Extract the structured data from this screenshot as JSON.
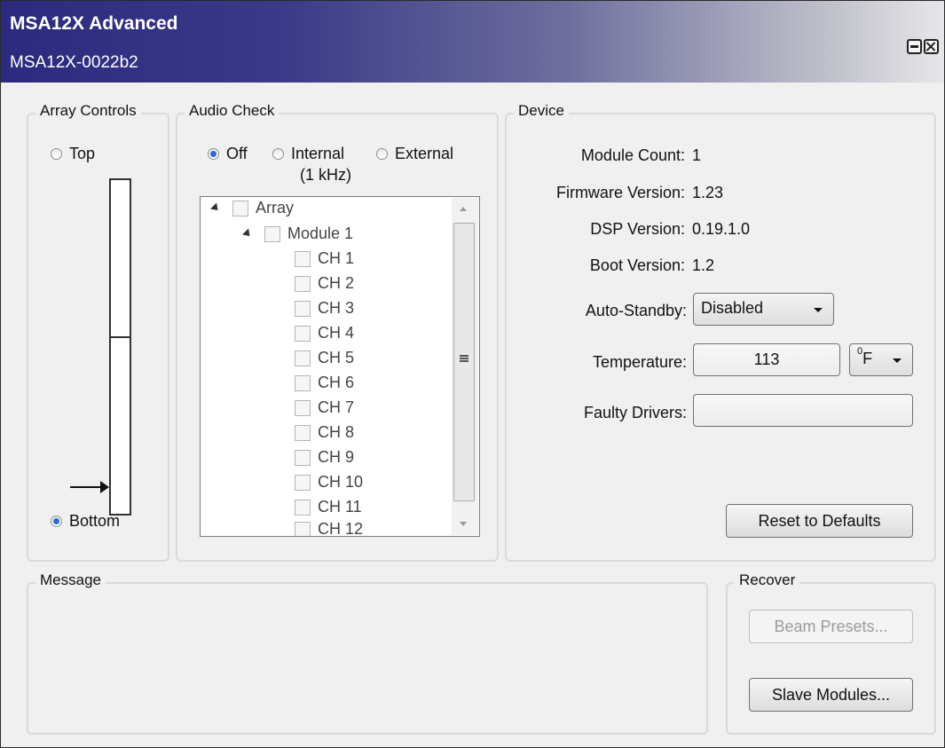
{
  "window": {
    "app_title": "MSA12X Advanced",
    "device_name": "MSA12X-0022b2"
  },
  "array_controls": {
    "legend": "Array Controls",
    "top_label": "Top",
    "bottom_label": "Bottom",
    "selected": "Bottom"
  },
  "audio_check": {
    "legend": "Audio Check",
    "options": [
      {
        "label": "Off",
        "selected": true
      },
      {
        "label": "Internal",
        "sublabel": "(1 kHz)",
        "selected": false
      },
      {
        "label": "External",
        "selected": false
      }
    ],
    "tree": {
      "root": "Array",
      "module": "Module 1",
      "channels": [
        "CH 1",
        "CH 2",
        "CH 3",
        "CH 4",
        "CH 5",
        "CH 6",
        "CH 7",
        "CH 8",
        "CH 9",
        "CH 10",
        "CH 11",
        "CH 12"
      ]
    }
  },
  "device": {
    "legend": "Device",
    "module_count_label": "Module Count:",
    "module_count": "1",
    "firmware_label": "Firmware Version:",
    "firmware": "1.23",
    "dsp_label": "DSP Version:",
    "dsp": "0.19.1.0",
    "boot_label": "Boot Version:",
    "boot": "1.2",
    "auto_standby_label": "Auto-Standby:",
    "auto_standby": "Disabled",
    "temperature_label": "Temperature:",
    "temperature": "113",
    "temp_unit_degree": "0",
    "temp_unit_letter": "F",
    "faulty_label": "Faulty Drivers:",
    "faulty": "",
    "reset_button": "Reset to Defaults"
  },
  "message": {
    "legend": "Message",
    "text": ""
  },
  "recover": {
    "legend": "Recover",
    "beam_presets_button": "Beam Presets...",
    "slave_modules_button": "Slave Modules..."
  },
  "colors": {
    "title_gradient_start": "#2b2a7e",
    "radio_accent": "#2b6ec9"
  }
}
